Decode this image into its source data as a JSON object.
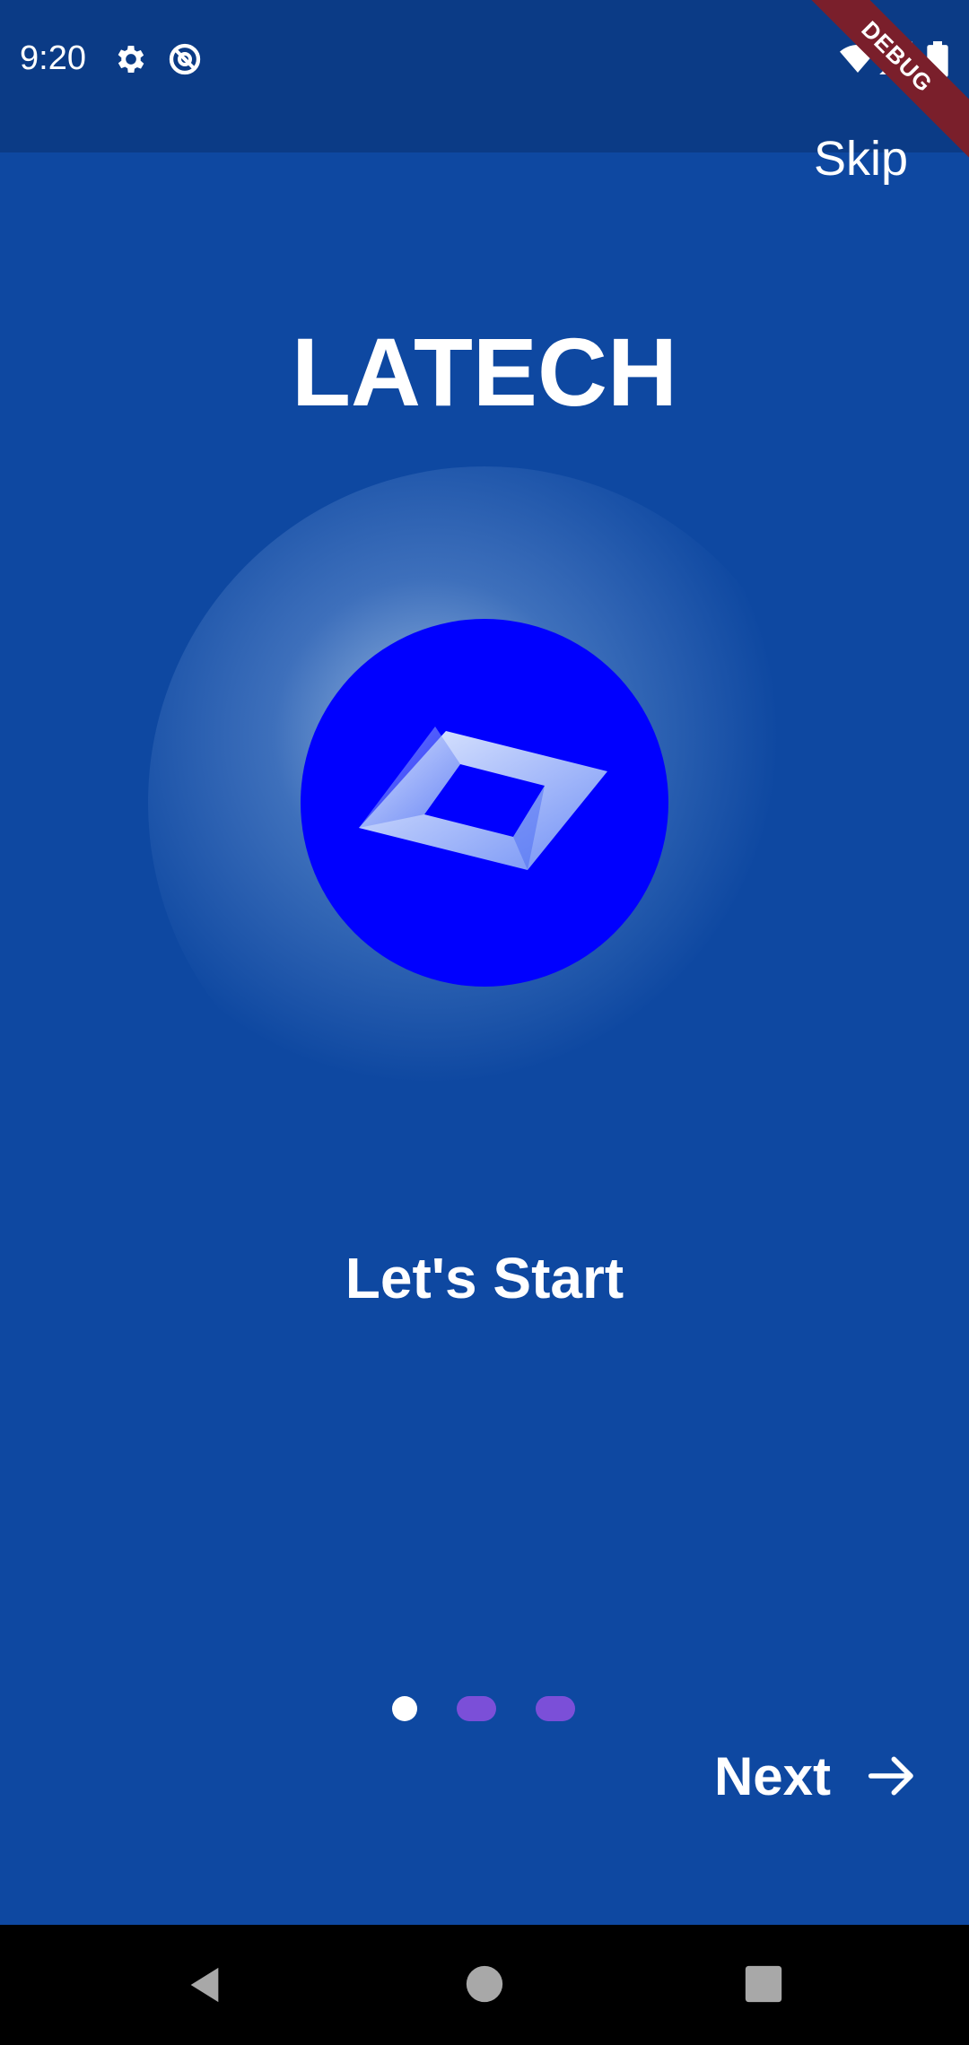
{
  "status_bar": {
    "time": "9:20",
    "debug_label": "DEBUG",
    "left_icons": [
      "gear-icon",
      "at-sign-icon"
    ],
    "right_icons": [
      "wifi-icon",
      "signal-icon",
      "battery-icon"
    ]
  },
  "onboarding": {
    "skip_label": "Skip",
    "app_title": "LATECH",
    "subtitle": "Let's Start",
    "page_indicator": {
      "current_page": 1,
      "total_pages": 3,
      "active_color": "#ffffff",
      "inactive_color": "#7b4fd8"
    },
    "next_label": "Next"
  },
  "colors": {
    "background": "#0e48a1",
    "status_bar": "#0b3b86",
    "logo_circle": "#0000ff",
    "debug_banner": "#7a1f2b"
  },
  "nav_bar": {
    "buttons": [
      "back-icon",
      "home-icon",
      "recents-icon"
    ]
  }
}
